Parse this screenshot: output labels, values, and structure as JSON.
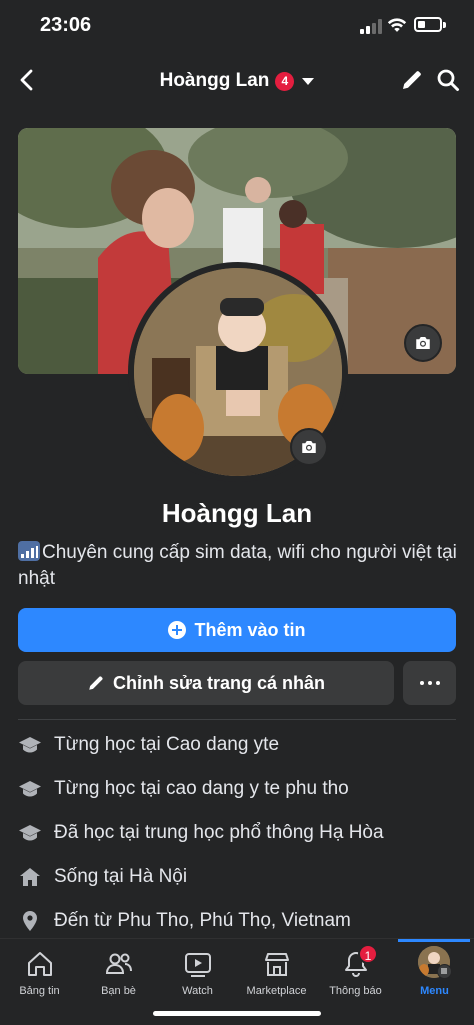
{
  "status_bar": {
    "time": "23:06",
    "battery_percent": 0.35
  },
  "header": {
    "title": "Hoàngg Lan",
    "notification_count": "4"
  },
  "profile": {
    "name": "Hoàngg Lan",
    "bio": "Chuyên cung cấp sim data, wifi cho người việt tại nhật"
  },
  "actions": {
    "add_story": "Thêm vào tin",
    "edit_profile": "Chỉnh sửa trang cá nhân"
  },
  "intro": [
    {
      "icon": "graduation-cap-icon",
      "text": "Từng học tại Cao dang yte"
    },
    {
      "icon": "graduation-cap-icon",
      "text": "Từng học tại cao dang y te phu tho"
    },
    {
      "icon": "graduation-cap-icon",
      "text": "Đã học tại trung học phổ thông Hạ Hòa"
    },
    {
      "icon": "home-icon",
      "text": "Sống tại Hà Nội"
    },
    {
      "icon": "location-pin-icon",
      "text": "Đến từ Phu Tho, Phú Thọ, Vietnam"
    }
  ],
  "tabs": [
    {
      "label": "Bảng tin",
      "icon": "home-icon"
    },
    {
      "label": "Bạn bè",
      "icon": "friends-icon"
    },
    {
      "label": "Watch",
      "icon": "watch-icon"
    },
    {
      "label": "Marketplace",
      "icon": "marketplace-icon"
    },
    {
      "label": "Thông báo",
      "icon": "bell-icon",
      "badge": "1"
    },
    {
      "label": "Menu",
      "icon": "profile-avatar",
      "active": true
    }
  ],
  "colors": {
    "background": "#242526",
    "accent": "#2d88ff",
    "badge": "#e41e3f",
    "button_secondary": "#3a3b3c"
  }
}
